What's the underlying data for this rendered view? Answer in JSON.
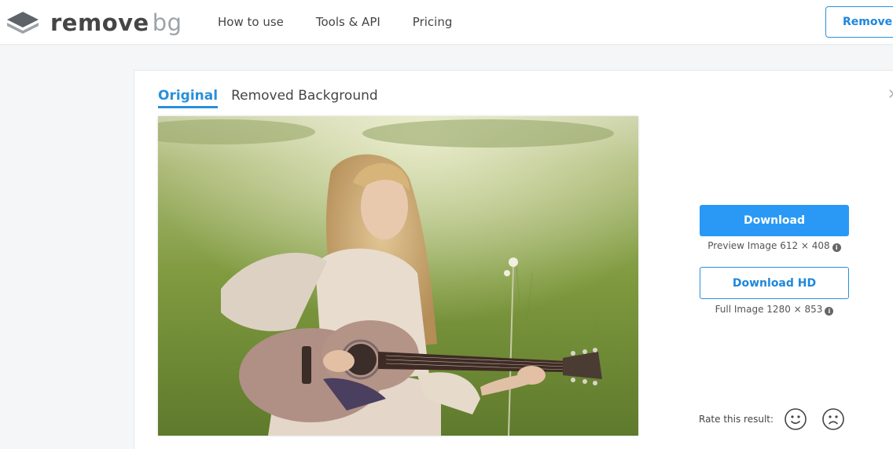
{
  "header": {
    "logo": {
      "word1": "remove",
      "word2": "bg"
    },
    "nav": [
      "How to use",
      "Tools & API",
      "Pricing"
    ],
    "cta_label": "Remove Background"
  },
  "tabs": [
    {
      "label": "Original",
      "active": true
    },
    {
      "label": "Removed Background",
      "active": false
    }
  ],
  "close_icon": "✕",
  "photo": {
    "description_icon": "photo-of-woman-with-guitar-in-field"
  },
  "download": {
    "label": "Download",
    "caption": "Preview Image 612 × 408"
  },
  "download_hd": {
    "label": "Download HD",
    "caption": "Full Image 1280 × 853"
  },
  "rating": {
    "label": "Rate this result:",
    "icons": [
      "smiley-happy-icon",
      "smiley-sad-icon"
    ]
  },
  "colors": {
    "accent": "#2a99f5",
    "accent_text": "#1f87db",
    "logo_dark": "#454545",
    "logo_light": "#9ea3a7"
  }
}
